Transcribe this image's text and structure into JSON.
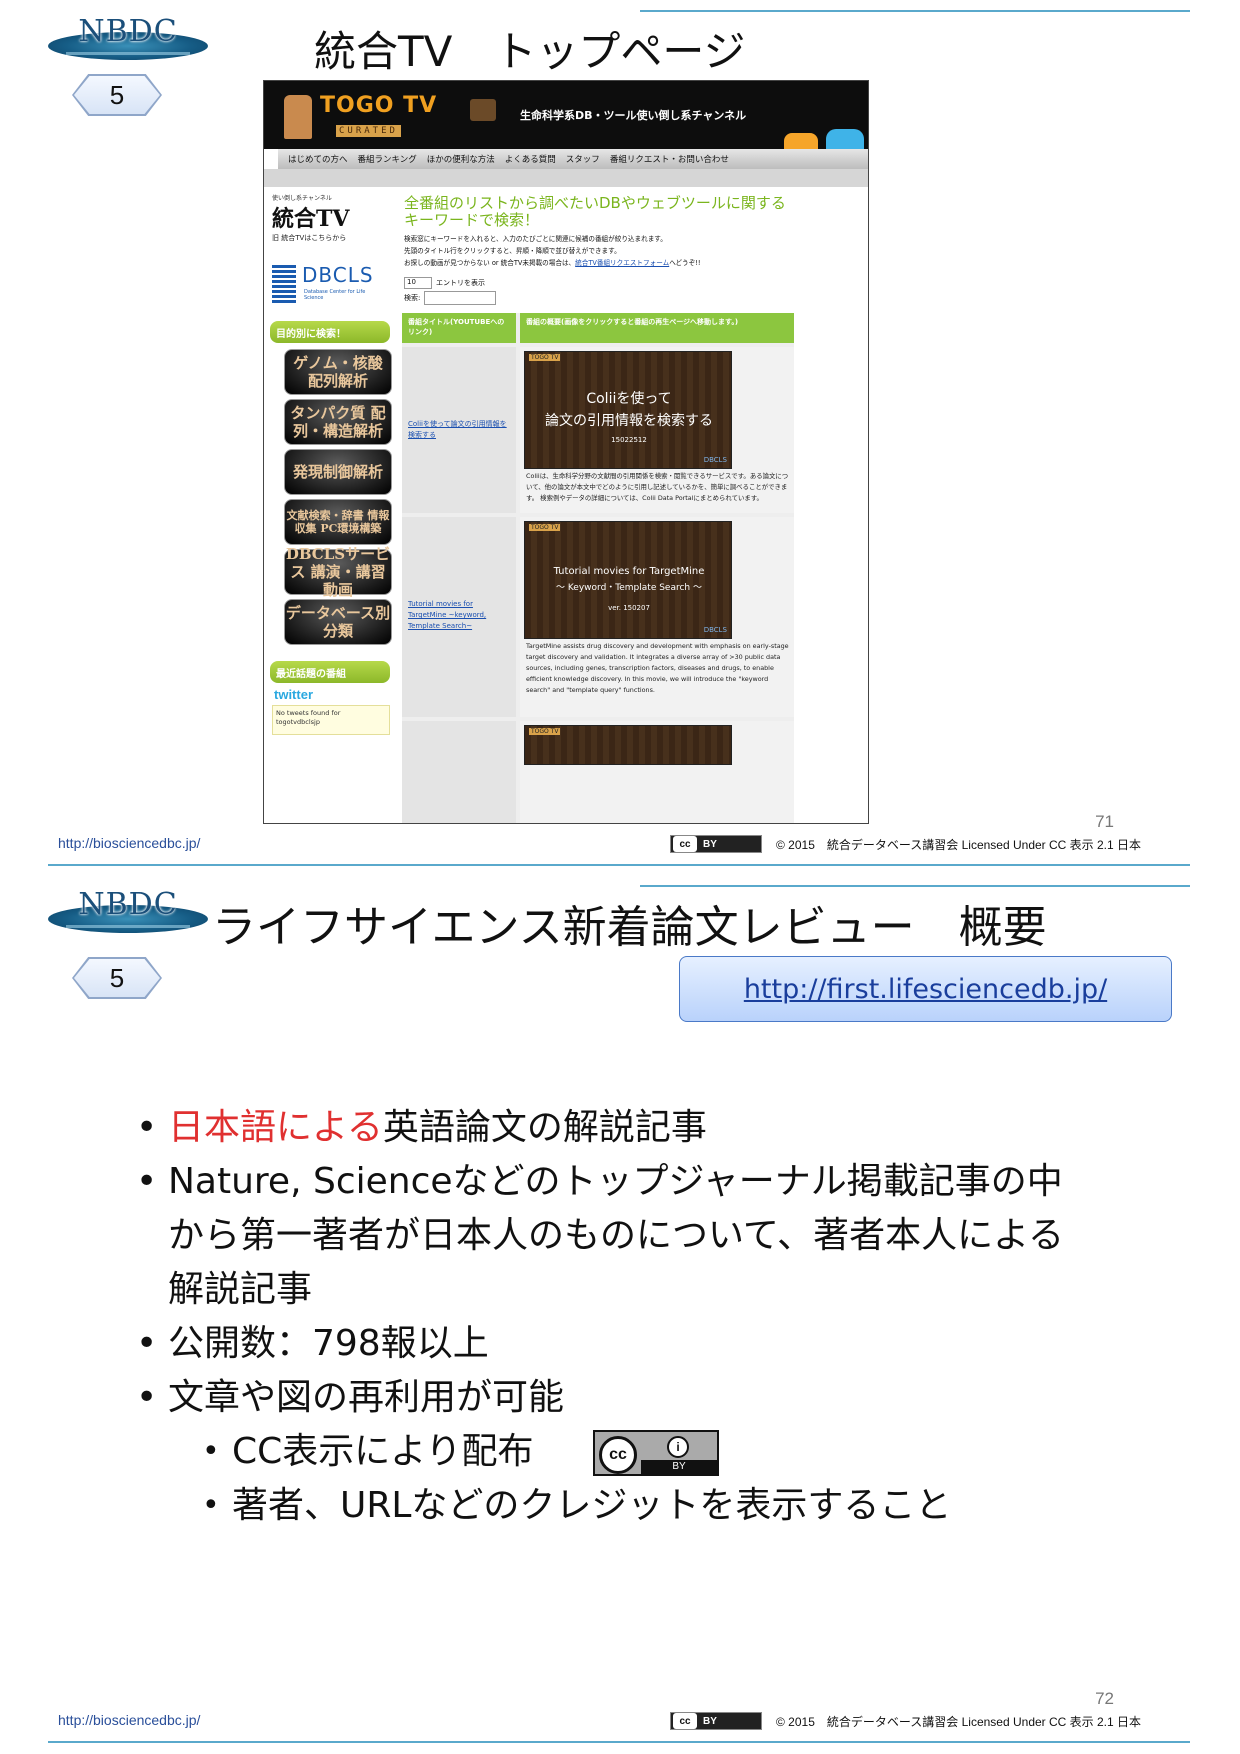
{
  "slide1": {
    "badge": "5",
    "logo": "NBDC",
    "title": "統合TV　トップページ",
    "page_number": "71",
    "footer_url": "http://biosciencedbc.jp/",
    "cc_label": "BY",
    "copyright": "© 2015　統合データベース講習会 Licensed Under CC 表示 2.1 日本",
    "screenshot": {
      "site_title": "TOGO TV",
      "curated": "CURATED",
      "tagline": "生命科学系DB・ツール使い倒し系チャンネル",
      "nav": [
        "はじめての方へ",
        "番組ランキング",
        "ほかの便利な方法",
        "よくある質問",
        "スタッフ",
        "番組リクエスト・お問い合わせ"
      ],
      "side_logo_caption": "使い倒し系チャンネル",
      "side_logo": "統合TV",
      "side_link": "旧 統合TVはこちらから",
      "dbcls": "DBCLS",
      "dbcls_sub": "Database Center for Life Science",
      "search_by_purpose": "目的別に検索！",
      "categories": [
        "ゲノム・核酸 配列解析",
        "タンパク質 配列・構造解析",
        "発現制御解析",
        "文献検索・辞書 情報収集 PC環境構築",
        "DBCLSサービス 講演・講習動画",
        "データベース別 分類"
      ],
      "recent_topics": "最近話題の番組",
      "twitter": "twitter",
      "tweets_empty": "No tweets found for togotvdbclsjp",
      "main_title": "全番組のリストから調べたいDBやウェブツールに関するキーワードで検索！",
      "main_text_1": "検索窓にキーワードを入れると、入力のたびごとに関連に候補の番組が絞り込まれます。",
      "main_text_2": "先頭のタイトル行をクリックすると、昇順・降順で並び替えができます。",
      "main_text_3": "お探しの動画が見つからない or 統合TV未掲載の場合は、",
      "main_text_link": "統合TV番組リクエストフォーム",
      "main_text_4": "へどうぞ!!",
      "entries_value": "10",
      "entries_label": "エントリを表示",
      "search_label": "検索:",
      "col1_header": "番組タイトル(YOUTUBEへのリンク)",
      "col2_header": "番組の概要(画像をクリックすると番組の再生ページへ移動します。)",
      "rows": [
        {
          "link": "Coliiを使って論文の引用情報を検索する",
          "badge": "TOGO TV",
          "thumb_line1": "Coliiを使って",
          "thumb_line2": "論文の引用情報を検索する",
          "thumb_date": "15022512",
          "desc": "Coliiは、生命科学分野の文献間の引用関係を検索・閲覧できるサービスです。ある論文について、他の論文が本文中でどのように引用し記述しているかを、簡単に調べることができます。 検索例やデータの詳細については、Colii Data Portalにまとめられています。"
        },
        {
          "link": "Tutorial movies for TargetMine ~keyword, Template Search~",
          "badge": "TOGO TV",
          "thumb_line1": "Tutorial movies for TargetMine",
          "thumb_line2": "～ Keyword・Template Search ～",
          "thumb_date": "ver. 150207",
          "desc": "TargetMine assists drug discovery and development with emphasis on early-stage target discovery and validation. It integrates a diverse array of >30 public data sources, including genes, transcription factors, diseases and drugs, to enable efficient knowledge discovery. In this movie, we will introduce the \"keyword search\" and \"template query\" functions."
        }
      ]
    }
  },
  "slide2": {
    "badge": "5",
    "logo": "NBDC",
    "title": "ライフサイエンス新着論文レビュー　概要",
    "url": "http://first.lifesciencedb.jp/",
    "bullet1_red": "日本語による",
    "bullet1_rest": "英語論文の解説記事",
    "bullet2": "Nature, Scienceなどのトップジャーナル掲載記事の中から第一著者が日本人のものについて、著者本人による解説記事",
    "bullet3": "公開数：798報以上",
    "bullet4": "文章や図の再利用が可能",
    "sub1": "CC表示により配布",
    "sub2": "著者、URLなどのクレジットを表示すること",
    "cc_label": "BY",
    "page_number": "72",
    "footer_url": "http://biosciencedbc.jp/",
    "copyright": "© 2015　統合データベース講習会 Licensed Under CC 表示 2.1 日本"
  }
}
